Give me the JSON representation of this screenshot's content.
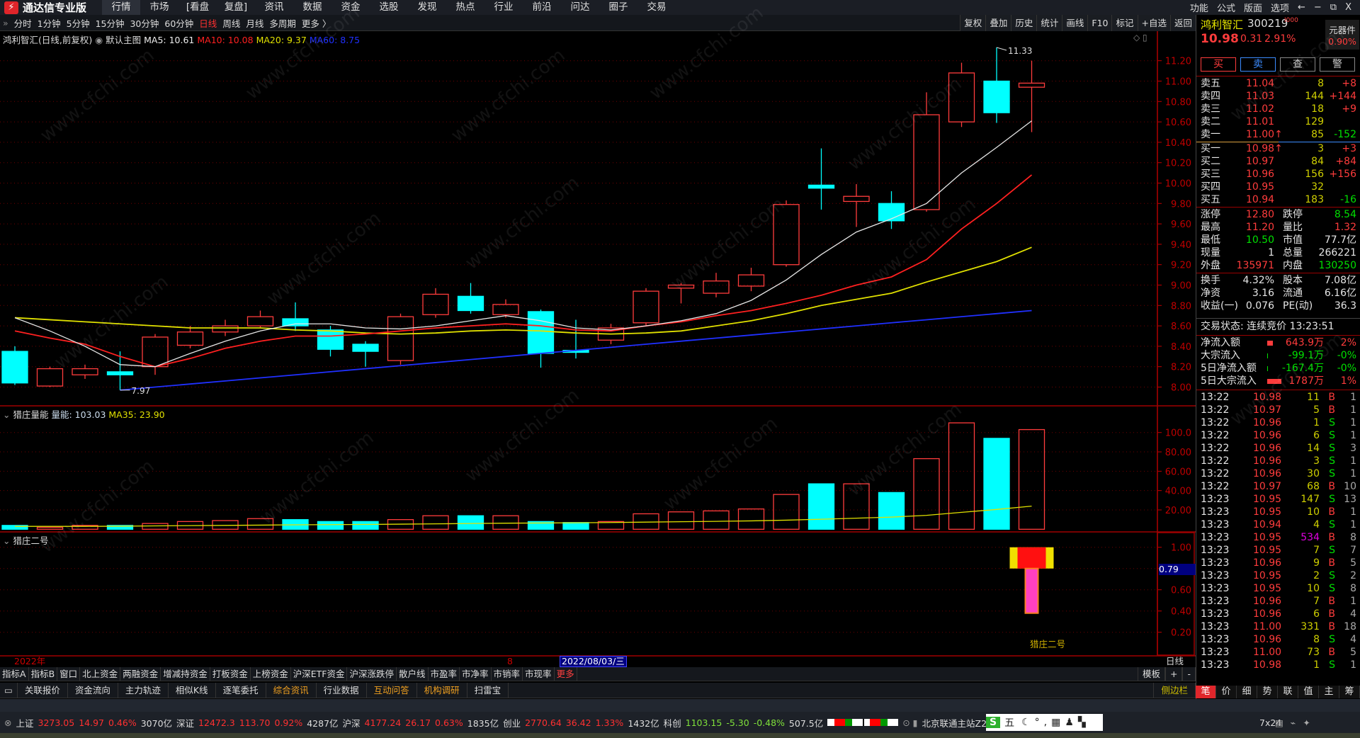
{
  "app": {
    "title": "通达信专业版",
    "menu": [
      "行情",
      "市场",
      "[看盘",
      "复盘]",
      "资讯",
      "数据",
      "资金",
      "选股",
      "发现",
      "热点",
      "行业",
      "前沿",
      "问达",
      "圈子",
      "交易"
    ],
    "active_menu": "行情",
    "right_menu": [
      "功能",
      "公式",
      "版面",
      "选项"
    ],
    "window_controls": [
      "←",
      "−",
      "⧉",
      "X"
    ]
  },
  "toolbar": {
    "periods": [
      "分时",
      "1分钟",
      "5分钟",
      "15分钟",
      "30分钟",
      "60分钟",
      "日线",
      "周线",
      "月线",
      "多周期",
      "更多 〉"
    ],
    "active_period": "日线",
    "right_buttons": [
      "复权",
      "叠加",
      "历史",
      "统计",
      "画线",
      "F10",
      "标记",
      "+自选",
      "返回"
    ]
  },
  "info": {
    "stock_title": "鸿利智汇(日线,前复权)",
    "main_chart": "默认主图",
    "ma5": "MA5: 10.61",
    "ma10": "MA10: 10.08",
    "ma20": "MA20: 9.37",
    "ma60": "MA60: 8.75"
  },
  "volume_panel": {
    "title": "猎庄量能",
    "value": "量能: 103.03",
    "ma35": "MA35: 23.90"
  },
  "panel3": {
    "title": "猎庄二号",
    "label": "猎庄二号",
    "cursor_value": "0.79"
  },
  "date_axis": {
    "year": "2022年",
    "month": "8",
    "cursor_date": "2022/08/03/三",
    "period": "日线"
  },
  "watermark": "www.cfchi.com",
  "chart_data": {
    "type": "candlestick",
    "ohlc": [
      [
        8.35,
        8.4,
        8.02,
        8.04
      ],
      [
        8.01,
        8.2,
        8.0,
        8.18
      ],
      [
        8.12,
        8.22,
        8.08,
        8.18
      ],
      [
        8.15,
        8.35,
        7.97,
        8.12
      ],
      [
        8.2,
        8.52,
        8.12,
        8.49
      ],
      [
        8.41,
        8.6,
        8.38,
        8.54
      ],
      [
        8.54,
        8.66,
        8.5,
        8.6
      ],
      [
        8.6,
        8.75,
        8.58,
        8.69
      ],
      [
        8.67,
        8.83,
        8.55,
        8.6
      ],
      [
        8.56,
        8.6,
        8.3,
        8.37
      ],
      [
        8.42,
        8.45,
        8.2,
        8.35
      ],
      [
        8.26,
        8.72,
        8.22,
        8.69
      ],
      [
        8.71,
        8.97,
        8.68,
        8.91
      ],
      [
        8.89,
        9.02,
        8.72,
        8.75
      ],
      [
        8.71,
        8.86,
        8.68,
        8.81
      ],
      [
        8.74,
        8.76,
        8.19,
        8.33
      ],
      [
        8.36,
        8.66,
        8.28,
        8.34
      ],
      [
        8.46,
        8.62,
        8.42,
        8.58
      ],
      [
        8.63,
        8.97,
        8.6,
        8.94
      ],
      [
        8.97,
        9.02,
        8.82,
        9.0
      ],
      [
        8.92,
        9.12,
        8.88,
        9.04
      ],
      [
        8.99,
        9.17,
        8.94,
        9.1
      ],
      [
        9.2,
        9.83,
        9.18,
        9.79
      ],
      [
        9.98,
        10.34,
        9.74,
        9.95
      ],
      [
        9.82,
        9.99,
        9.57,
        9.87
      ],
      [
        9.8,
        9.92,
        9.55,
        9.63
      ],
      [
        9.74,
        10.89,
        9.72,
        10.67
      ],
      [
        10.6,
        11.18,
        10.55,
        11.08
      ],
      [
        11.0,
        11.33,
        10.59,
        10.69
      ],
      [
        10.94,
        11.2,
        10.5,
        10.98
      ]
    ],
    "ma5": [
      8.68,
      8.55,
      8.4,
      8.22,
      8.2,
      8.33,
      8.45,
      8.55,
      8.62,
      8.62,
      8.58,
      8.57,
      8.6,
      8.65,
      8.7,
      8.65,
      8.58,
      8.56,
      8.6,
      8.65,
      8.72,
      8.85,
      9.05,
      9.3,
      9.52,
      9.65,
      9.8,
      10.1,
      10.35,
      10.61
    ],
    "ma10": [
      8.55,
      8.48,
      8.42,
      8.3,
      8.2,
      8.28,
      8.38,
      8.45,
      8.5,
      8.5,
      8.52,
      8.55,
      8.58,
      8.6,
      8.62,
      8.6,
      8.56,
      8.55,
      8.6,
      8.64,
      8.7,
      8.75,
      8.82,
      8.9,
      9.0,
      9.08,
      9.25,
      9.55,
      9.8,
      10.08
    ],
    "ma20": [
      8.68,
      8.66,
      8.64,
      8.62,
      8.6,
      8.58,
      8.58,
      8.58,
      8.56,
      8.55,
      8.53,
      8.52,
      8.53,
      8.55,
      8.56,
      8.55,
      8.53,
      8.52,
      8.53,
      8.55,
      8.6,
      8.65,
      8.72,
      8.8,
      8.86,
      8.92,
      9.03,
      9.13,
      9.23,
      9.37
    ],
    "ma60": [
      null,
      null,
      null,
      7.97,
      8.0,
      8.03,
      8.06,
      8.09,
      8.12,
      8.15,
      8.18,
      8.21,
      8.24,
      8.27,
      8.3,
      8.33,
      8.36,
      8.39,
      8.42,
      8.45,
      8.48,
      8.51,
      8.54,
      8.57,
      8.6,
      8.63,
      8.66,
      8.69,
      8.72,
      8.75
    ],
    "ma_colors": {
      "ma5": "#e6e6e6",
      "ma10": "#ff2020",
      "ma20": "#e0e000",
      "ma60": "#2030ff"
    },
    "up_color": "#ff3c3c",
    "down_color": "#00ffff",
    "price_ticks": [
      "11.20",
      "11.00",
      "10.80",
      "10.60",
      "10.40",
      "10.20",
      "10.00",
      "9.80",
      "9.60",
      "9.40",
      "9.20",
      "9.00",
      "8.80",
      "8.60",
      "8.40",
      "8.20",
      "8.00"
    ],
    "ylim": [
      8.0,
      11.2
    ],
    "high_label": "11.33",
    "low_label": "7.97",
    "volume": [
      4,
      2,
      4,
      4,
      6,
      8,
      9,
      11,
      10,
      8,
      8,
      10,
      14,
      14,
      14,
      8,
      7,
      8,
      16,
      18,
      19,
      21,
      36,
      47,
      47,
      38,
      73,
      110,
      94,
      103.03
    ],
    "volume_ma35": [
      3,
      3,
      3,
      3.2,
      3.5,
      3.8,
      4,
      4.3,
      4.6,
      4.8,
      5,
      5.3,
      5.6,
      6,
      6.3,
      6.5,
      6.7,
      7,
      7.4,
      7.8,
      8.2,
      8.7,
      9.4,
      10.4,
      11.5,
      12.6,
      14.4,
      17.5,
      20.5,
      23.9
    ],
    "volume_ticks": [
      "100.0",
      "80.00",
      "60.00",
      "40.00",
      "20.00"
    ],
    "panel3_ticks": [
      "1.00",
      "0.80",
      "0.60",
      "0.40",
      "0.20"
    ],
    "panel3_signal": {
      "bar_top": 1.0,
      "bar_bottom": 0.8,
      "stem_bottom": 0.38
    }
  },
  "quote": {
    "name": "鸿利智汇",
    "code": "300219",
    "code_suffix": "I000",
    "price": "10.98",
    "change": "0.31",
    "pct": "2.91%",
    "sector": "元器件",
    "sector_pct": "0.90%",
    "buttons": [
      "买",
      "卖",
      "查",
      "警"
    ],
    "asks": [
      [
        "卖五",
        "11.04",
        "8",
        "+8"
      ],
      [
        "卖四",
        "11.03",
        "144",
        "+144"
      ],
      [
        "卖三",
        "11.02",
        "18",
        "+9"
      ],
      [
        "卖二",
        "11.01",
        "129",
        ""
      ],
      [
        "卖一",
        "11.00↑",
        "85",
        "-152"
      ]
    ],
    "bids": [
      [
        "买一",
        "10.98↑",
        "3",
        "+3"
      ],
      [
        "买二",
        "10.97",
        "84",
        "+84"
      ],
      [
        "买三",
        "10.96",
        "156",
        "+156"
      ],
      [
        "买四",
        "10.95",
        "32",
        ""
      ],
      [
        "买五",
        "10.94",
        "183",
        "-16"
      ]
    ],
    "stats": [
      [
        "涨停",
        "12.80",
        "跌停",
        "8.54"
      ],
      [
        "最高",
        "11.20",
        "量比",
        "1.32"
      ],
      [
        "最低",
        "10.50",
        "市值",
        "77.7亿"
      ],
      [
        "现量",
        "1",
        "总量",
        "266221"
      ],
      [
        "外盘",
        "135971",
        "内盘",
        "130250"
      ]
    ],
    "stats2": [
      [
        "换手",
        "4.32%",
        "股本",
        "7.08亿"
      ],
      [
        "净资",
        "3.16",
        "流通",
        "6.16亿"
      ],
      [
        "收益(一)",
        "0.076",
        "PE(动)",
        "36.3"
      ]
    ],
    "trade_status": "交易状态: 连续竞价 13:23:51",
    "flows": [
      [
        "净流入额",
        "643.9万",
        "2%"
      ],
      [
        "大宗流入",
        "-99.1万",
        "-0%"
      ],
      [
        "5日净流入额",
        "-167.4万",
        "-0%"
      ],
      [
        "5日大宗流入",
        "1787万",
        "1%"
      ]
    ],
    "ticks": [
      [
        "13:22",
        "10.98",
        "11",
        "B",
        "1"
      ],
      [
        "13:22",
        "10.97",
        "5",
        "B",
        "1"
      ],
      [
        "13:22",
        "10.96",
        "1",
        "S",
        "1"
      ],
      [
        "13:22",
        "10.96",
        "6",
        "S",
        "1"
      ],
      [
        "13:22",
        "10.96",
        "14",
        "S",
        "3"
      ],
      [
        "13:22",
        "10.96",
        "3",
        "S",
        "1"
      ],
      [
        "13:22",
        "10.96",
        "30",
        "S",
        "1"
      ],
      [
        "13:22",
        "10.97",
        "68",
        "B",
        "10"
      ],
      [
        "13:23",
        "10.95",
        "147",
        "S",
        "13"
      ],
      [
        "13:23",
        "10.95",
        "10",
        "B",
        "1"
      ],
      [
        "13:23",
        "10.94",
        "4",
        "S",
        "1"
      ],
      [
        "13:23",
        "10.95",
        "534",
        "B",
        "8"
      ],
      [
        "13:23",
        "10.95",
        "7",
        "S",
        "7"
      ],
      [
        "13:23",
        "10.96",
        "9",
        "B",
        "5"
      ],
      [
        "13:23",
        "10.95",
        "2",
        "S",
        "2"
      ],
      [
        "13:23",
        "10.95",
        "10",
        "S",
        "8"
      ],
      [
        "13:23",
        "10.96",
        "7",
        "B",
        "1"
      ],
      [
        "13:23",
        "10.96",
        "6",
        "B",
        "4"
      ],
      [
        "13:23",
        "11.00",
        "331",
        "B",
        "18"
      ],
      [
        "13:23",
        "10.96",
        "8",
        "S",
        "4"
      ],
      [
        "13:23",
        "11.00",
        "73",
        "B",
        "5"
      ],
      [
        "13:23",
        "10.98",
        "1",
        "S",
        "1"
      ]
    ],
    "tabs": [
      "笔",
      "价",
      "细",
      "势",
      "联",
      "值",
      "主",
      "筹"
    ]
  },
  "bottom_tabs1": [
    "指标A",
    "指标B",
    "窗口",
    "北上资金",
    "两融资金",
    "增减持资金",
    "打板资金",
    "上榜资金",
    "沪深ETF资金",
    "沪深涨跌停",
    "散户线",
    "市盈率",
    "市净率",
    "市销率",
    "市现率",
    "更多"
  ],
  "bottom_tabs1_right": [
    "模板",
    "+",
    "-"
  ],
  "bottom_tabs2": [
    "关联报价",
    "资金流向",
    "主力轨迹",
    "相似K线",
    "逐笔委托",
    "综合资讯",
    "行业数据",
    "互动问答",
    "机构调研",
    "扫雷宝"
  ],
  "bottom_tabs2_right": "侧边栏",
  "status": {
    "indices": [
      [
        "上证",
        "3273.05",
        "14.97",
        "0.46%",
        "3070亿"
      ],
      [
        "深证",
        "12472.3",
        "113.70",
        "0.92%",
        "4287亿"
      ],
      [
        "沪深",
        "4177.24",
        "26.17",
        "0.63%",
        "1835亿"
      ],
      [
        "创业",
        "2770.64",
        "36.42",
        "1.33%",
        "1432亿"
      ],
      [
        "科创",
        "1103.15",
        "-5.30",
        "-0.48%",
        "507.5亿"
      ]
    ],
    "server": "北京联通主站Z2",
    "ime": "五",
    "clock_label": "7x24"
  }
}
